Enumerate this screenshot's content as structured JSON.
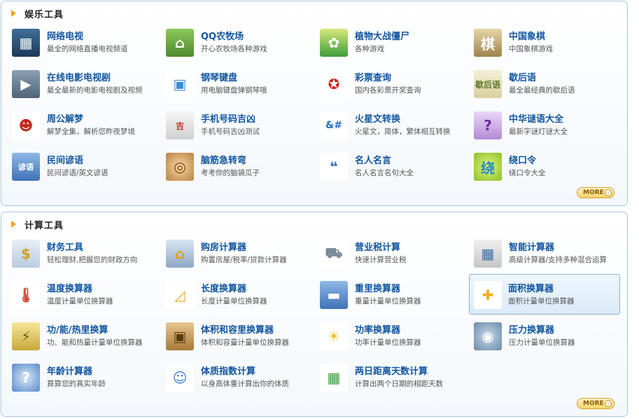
{
  "entertainment": {
    "title": "娱乐工具",
    "more_label": "MORE",
    "items": [
      {
        "title": "网络电视",
        "desc": "最全的网络直播电视频道",
        "icon": "tv-icon",
        "glyph": "▦"
      },
      {
        "title": "QQ农牧场",
        "desc": "开心农牧场各种游戏",
        "icon": "farm-icon",
        "glyph": "⌂"
      },
      {
        "title": "植物大战僵尸",
        "desc": "各种游戏",
        "icon": "plants-vs-zombies-icon",
        "glyph": "✿"
      },
      {
        "title": "中国象棋",
        "desc": "中国象棋游戏",
        "icon": "chinese-chess-icon",
        "glyph": "棋"
      },
      {
        "title": "在线电影电视剧",
        "desc": "最全最新的电影电视剧及视频",
        "icon": "movie-icon",
        "glyph": "▶"
      },
      {
        "title": "钢琴键盘",
        "desc": "用电脑键盘弹钢琴哦",
        "icon": "piano-icon",
        "glyph": "▣"
      },
      {
        "title": "彩票查询",
        "desc": "国内各彩票开奖查询",
        "icon": "lottery-icon",
        "glyph": "✪"
      },
      {
        "title": "歇后语",
        "desc": "最全最经典的歇后语",
        "icon": "xiehouyu-icon",
        "glyph": "歇后语"
      },
      {
        "title": "周公解梦",
        "desc": "解梦全集，解析您昨夜梦境",
        "icon": "dream-icon",
        "glyph": "☻"
      },
      {
        "title": "手机号码吉凶",
        "desc": "手机号码吉凶测试",
        "icon": "phone-number-icon",
        "glyph": "吉"
      },
      {
        "title": "火星文转换",
        "desc": "火星文，简体，繁体相互转换",
        "icon": "mars-text-icon",
        "glyph": "&#"
      },
      {
        "title": "中华谜语大全",
        "desc": "最新字谜灯谜大全",
        "icon": "riddle-icon",
        "glyph": "?"
      },
      {
        "title": "民间谚语",
        "desc": "民间谚语/英文谚语",
        "icon": "proverb-icon",
        "glyph": "谚语"
      },
      {
        "title": "脑筋急转弯",
        "desc": "考考你的脑袋瓜子",
        "icon": "brain-teaser-icon",
        "glyph": "◎"
      },
      {
        "title": "名人名言",
        "desc": "名人名言名句大全",
        "icon": "quote-icon",
        "glyph": "❝"
      },
      {
        "title": "绕口令",
        "desc": "绕口令大全",
        "icon": "tongue-twister-icon",
        "glyph": "绕"
      }
    ]
  },
  "calculators": {
    "title": "计算工具",
    "more_label": "MORE",
    "active_index": 7,
    "items": [
      {
        "title": "财务工具",
        "desc": "轻松理财,把握您的财政方向",
        "icon": "finance-icon",
        "glyph": "$"
      },
      {
        "title": "购房计算器",
        "desc": "购置房屋/税率/贷款计算器",
        "icon": "house-loan-icon",
        "glyph": "⌂"
      },
      {
        "title": "营业税计算",
        "desc": "快速计算营业税",
        "icon": "shopping-cart-icon",
        "glyph": "⛟"
      },
      {
        "title": "智能计算器",
        "desc": "高级计算器/支持多种混合运算",
        "icon": "calculator-icon",
        "glyph": "▦"
      },
      {
        "title": "温度换算器",
        "desc": "温度计量单位换算器",
        "icon": "thermometer-icon",
        "glyph": "🌡"
      },
      {
        "title": "长度换算器",
        "desc": "长度计量单位换算器",
        "icon": "ruler-icon",
        "glyph": "◿"
      },
      {
        "title": "重里换算器",
        "desc": "重量计量单位换算器",
        "icon": "weight-icon",
        "glyph": "▬"
      },
      {
        "title": "面积换算器",
        "desc": "面积计量单位换算器",
        "icon": "puzzle-icon",
        "glyph": "✚"
      },
      {
        "title": "功/能/热里换算",
        "desc": "功、能和热量计量单位换算器",
        "icon": "energy-icon",
        "glyph": "⚡"
      },
      {
        "title": "体积和容里换算器",
        "desc": "体积和容量计量单位换算器",
        "icon": "volume-box-icon",
        "glyph": "▣"
      },
      {
        "title": "功率换算器",
        "desc": "功率计量单位换算器",
        "icon": "lightbulb-icon",
        "glyph": "☀"
      },
      {
        "title": "压力换算器",
        "desc": "压力计量单位换算器",
        "icon": "pressure-gauge-icon",
        "glyph": "◉"
      },
      {
        "title": "年龄计算器",
        "desc": "算算您的真实年龄",
        "icon": "age-icon",
        "glyph": "?"
      },
      {
        "title": "体质指数计算",
        "desc": "以身高体重计算出你的体质",
        "icon": "bmi-icon",
        "glyph": "☺"
      },
      {
        "title": "两日距离天数计算",
        "desc": "计算出两个日期的相距天数",
        "icon": "calendar-icon",
        "glyph": "▦"
      }
    ]
  }
}
